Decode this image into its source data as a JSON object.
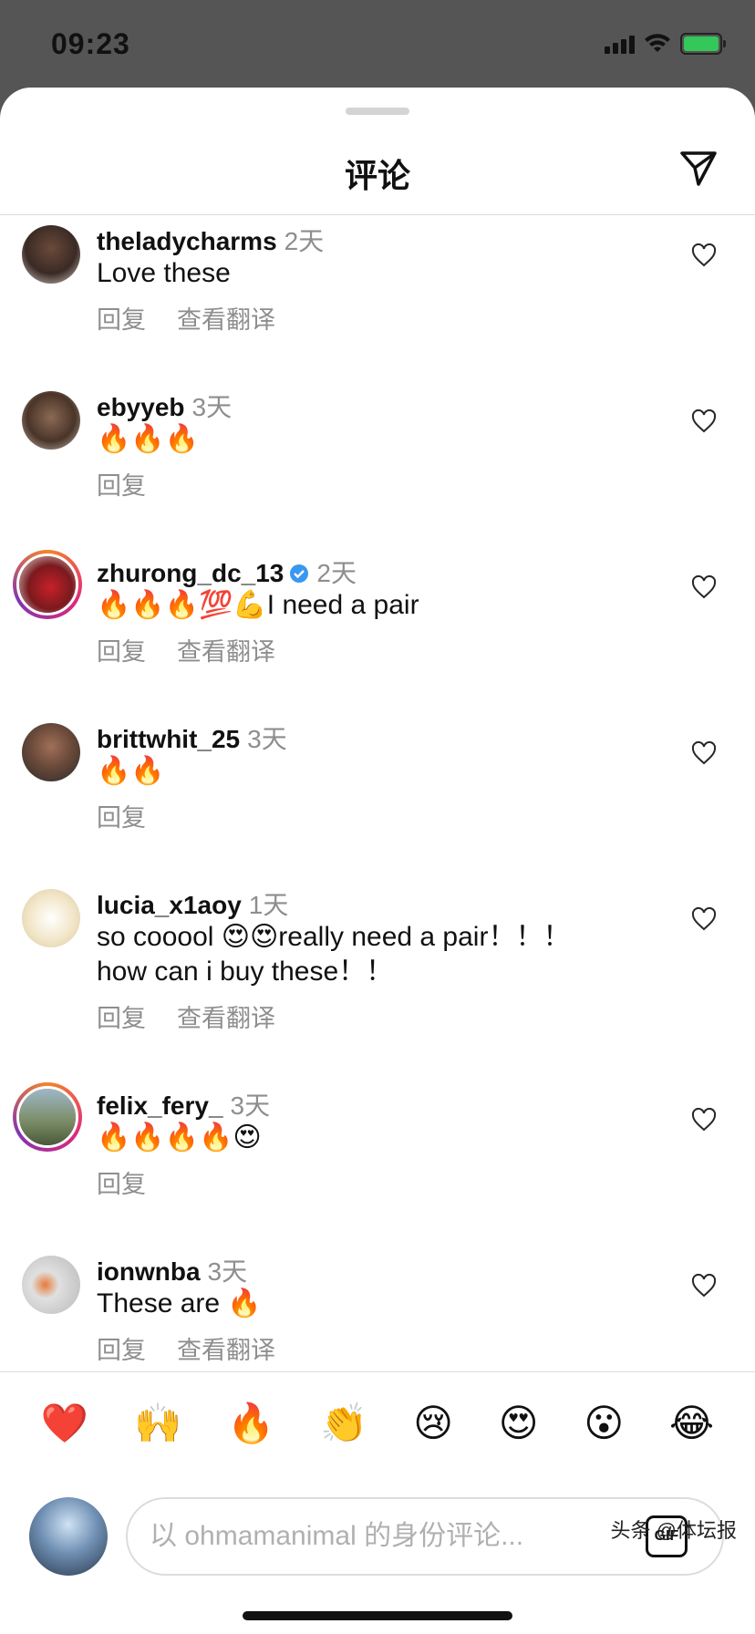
{
  "status_bar": {
    "time": "09:23"
  },
  "sheet": {
    "title": "评论"
  },
  "comments": [
    {
      "username": "theladycharms",
      "time": "2天",
      "text": "Love these",
      "reply": "回复",
      "translate": "查看翻译",
      "avatar_color": "#3a2a25"
    },
    {
      "username": "ebyyeb",
      "time": "3天",
      "text": "🔥🔥🔥",
      "reply": "回复",
      "translate": "",
      "avatar_color": "#4a3428"
    },
    {
      "username": "zhurong_dc_13",
      "time": "2天",
      "text": "🔥🔥🔥💯💪I need a pair",
      "reply": "回复",
      "translate": "查看翻译",
      "avatar_color": "#c8202a",
      "verified": true
    },
    {
      "username": "brittwhit_25",
      "time": "3天",
      "text": "🔥🔥",
      "reply": "回复",
      "translate": "",
      "avatar_color": "#6b4a3a"
    },
    {
      "username": "lucia_x1aoy",
      "time": "1天",
      "text": "so cooool 😍😍really need a pair！！！\nhow can i buy these！！",
      "reply": "回复",
      "translate": "查看翻译",
      "avatar_color": "#f2e6c8"
    },
    {
      "username": "felix_fery_",
      "time": "3天",
      "text": "🔥🔥🔥🔥😍",
      "reply": "回复",
      "translate": "",
      "avatar_color": "#7d8f6a"
    },
    {
      "username": "ionwnba",
      "time": "3天",
      "text": "These are 🔥",
      "reply": "回复",
      "translate": "查看翻译",
      "avatar_color": "#d0d0d0"
    }
  ],
  "emoji_bar": [
    "❤️",
    "🙌",
    "🔥",
    "👏",
    "😢",
    "😍",
    "😮",
    "😂"
  ],
  "composer": {
    "placeholder": "以 ohmamanimal 的身份评论...",
    "gif_label": "GIF"
  },
  "watermark": "头条 @体坛报",
  "colors": {
    "heart": "#262626",
    "verified": "#3897f0",
    "muted": "#8e8e8e"
  }
}
